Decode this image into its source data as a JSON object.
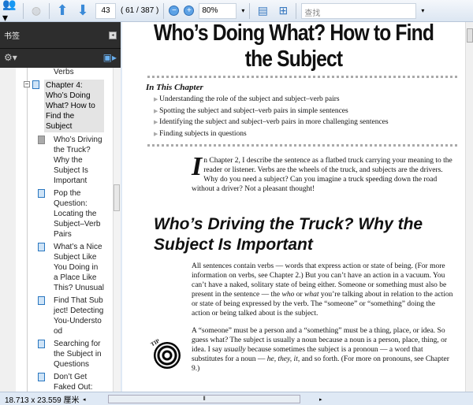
{
  "toolbar": {
    "page_number": "43",
    "page_count": "( 61 / 387 )",
    "zoom": "80%",
    "search_placeholder": "查找"
  },
  "sidebar": {
    "title": "书签",
    "items": [
      {
        "label": "Verbs"
      },
      {
        "label": "Chapter 4: Who’s Doing What? How to Find the Subject"
      },
      {
        "label": "Who’s Driving the Truck? Why the Subject Is Important"
      },
      {
        "label": "Pop the Question: Locating the Subject–Verb Pairs"
      },
      {
        "label": "What’s a Nice Subject Like You Doing in a Place Like This? Unusual"
      },
      {
        "label": "Find That Subject! Detecting You-Understood"
      },
      {
        "label": "Searching for the Subject in Questions"
      },
      {
        "label": "Don’t Get Faked Out: Avoiding Fake"
      }
    ]
  },
  "doc": {
    "title": "Who’s Doing What? How to Find the Subject",
    "in_this_chapter": "In This Chapter",
    "bullets": [
      "Understanding the role of the subject and subject–verb pairs",
      "Spotting the subject and subject–verb pairs in simple sentences",
      "Identifying the subject and subject–verb pairs in more challenging sentences",
      "Finding subjects in questions"
    ],
    "drop_cap": "I",
    "intro": "n Chapter 2, I describe the sentence as a flatbed truck carrying your meaning to the reader or listener. Verbs are the wheels of the truck, and subjects are the drivers. Why do you need a subject? Can you imagine a truck speeding down the road without a driver? Not a pleasant thought!",
    "section_heading": "Who’s Driving the Truck? Why the Subject Is Important",
    "para1": {
      "a": "All sentences contain verbs — words that express action or state of being. (For more information on verbs, see Chapter 2.) But you can’t have an action in a vacuum. You can’t have a naked, solitary state of being either. Someone or something must also be present in the sentence — the ",
      "who": "who",
      "b": " or ",
      "what": "what",
      "c": " you’re talking about in relation to the action or state of being expressed by the verb. The “someone” or “something” doing the action or being talked about is the subject."
    },
    "tip_label": "TIP",
    "para2": {
      "a": "A “someone” must be a person and a “something” must be a thing, place, or idea. So guess what? The subject is usually a noun because a noun is a person, place, thing, or idea. I say ",
      "usually": "usually",
      "b": " because sometimes the subject is a pronoun — a word that substitutes for a noun — ",
      "examples": "he, they, it,",
      "c": " and so forth. (For more on pronouns, see Chapter 9.)"
    }
  },
  "status": {
    "page_size": "18.713 x 23.559 厘米"
  }
}
